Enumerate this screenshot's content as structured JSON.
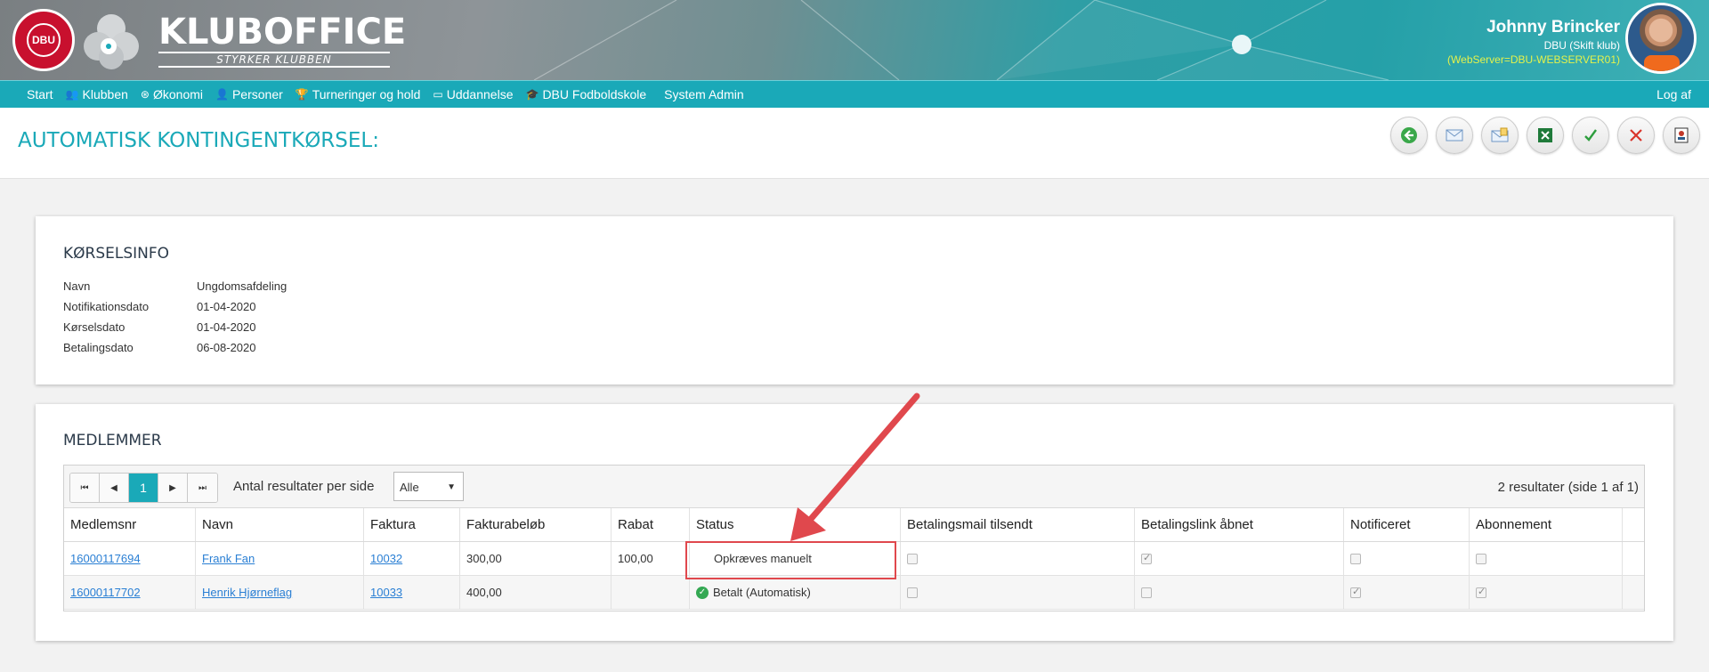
{
  "header": {
    "dbu_logo_text": "DBU",
    "brand_title": "KLUBOFFICE",
    "brand_subtitle": "STYRKER KLUBBEN",
    "user_name": "Johnny Brincker",
    "user_club": "DBU (Skift klub)",
    "user_server": "(WebServer=DBU-WEBSERVER01)"
  },
  "nav": {
    "items": [
      {
        "label": "Start",
        "icon": ""
      },
      {
        "label": "Klubben",
        "icon": "group-icon"
      },
      {
        "label": "Økonomi",
        "icon": "coin-icon"
      },
      {
        "label": "Personer",
        "icon": "person-icon"
      },
      {
        "label": "Turneringer og hold",
        "icon": "trophy-icon"
      },
      {
        "label": "Uddannelse",
        "icon": "screen-icon"
      },
      {
        "label": "DBU Fodboldskole",
        "icon": "graduation-cap-icon"
      },
      {
        "label": "System Admin",
        "icon": ""
      }
    ],
    "logout": "Log af"
  },
  "page": {
    "title": "AUTOMATISK KONTINGENTKØRSEL:"
  },
  "info": {
    "heading": "KØRSELSINFO",
    "rows": [
      {
        "label": "Navn",
        "value": "Ungdomsafdeling"
      },
      {
        "label": "Notifikationsdato",
        "value": "01-04-2020"
      },
      {
        "label": "Kørselsdato",
        "value": "01-04-2020"
      },
      {
        "label": "Betalingsdato",
        "value": "06-08-2020"
      }
    ]
  },
  "members": {
    "heading": "MEDLEMMER",
    "pager": {
      "first": "⏮",
      "prev": "◀",
      "current": "1",
      "next": "▶",
      "last": "⏭"
    },
    "per_page_label": "Antal resultater per side",
    "per_page_value": "Alle",
    "result_count": "2 resultater (side 1 af 1)",
    "columns": [
      "Medlemsnr",
      "Navn",
      "Faktura",
      "Fakturabeløb",
      "Rabat",
      "Status",
      "Betalingsmail tilsendt",
      "Betalingslink åbnet",
      "Notificeret",
      "Abonnement"
    ],
    "rows": [
      {
        "medlemsnr": "16000117694",
        "navn": "Frank Fan",
        "faktura": "10032",
        "belob": "300,00",
        "rabat": "100,00",
        "status": "Opkræves manuelt",
        "status_icon": "",
        "betalingsmail": false,
        "betalingslink": true,
        "notificeret": false,
        "abonnement": false
      },
      {
        "medlemsnr": "16000117702",
        "navn": "Henrik Hjørneflag",
        "faktura": "10033",
        "belob": "400,00",
        "rabat": "",
        "status": "Betalt (Automatisk)",
        "status_icon": "check-circle-icon",
        "betalingsmail": false,
        "betalingslink": false,
        "notificeret": true,
        "abonnement": true
      }
    ]
  },
  "colors": {
    "accent": "#1aa9b8",
    "link": "#2a7fd4",
    "annotation": "#e0484d",
    "server_text": "#e4f24b"
  }
}
